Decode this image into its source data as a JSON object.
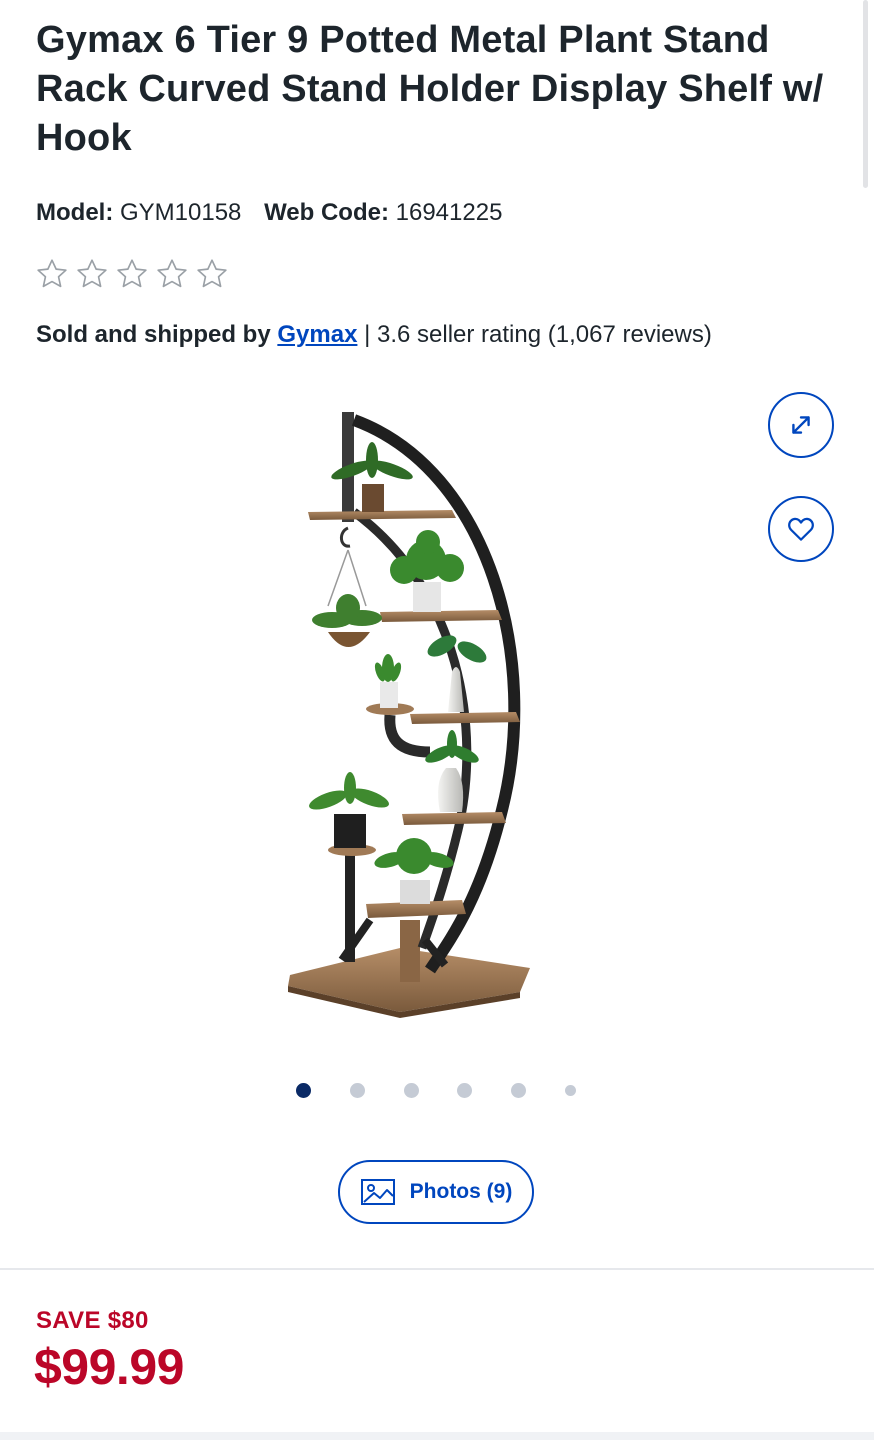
{
  "product": {
    "title": "Gymax 6 Tier 9 Potted Metal Plant Stand Rack Curved Stand Holder Display Shelf w/ Hook",
    "model_label": "Model:",
    "model_value": "GYM10158",
    "webcode_label": "Web Code:",
    "webcode_value": "16941225"
  },
  "rating": {
    "stars_filled": 0,
    "stars_total": 5
  },
  "seller": {
    "prefix": "Sold and shipped by",
    "name": "Gymax",
    "separator": "|",
    "rating_text": "3.6 seller rating (1,067 reviews)"
  },
  "gallery": {
    "image_alt": "Curved metal plant stand with wooden shelves and potted plants",
    "slide_count": 6,
    "active_slide": 1,
    "photos_button_label": "Photos (9)"
  },
  "icons": {
    "expand": "expand-icon",
    "favorite": "heart-icon",
    "photos": "image-icon",
    "star": "star-outline-icon"
  },
  "pricing": {
    "save_text": "SAVE $80",
    "price": "$99.99"
  },
  "colors": {
    "brand_blue": "#0046be",
    "sale_red": "#bb0628",
    "dot_active": "#0a2a66",
    "dot_inactive": "#c5cbd5"
  }
}
